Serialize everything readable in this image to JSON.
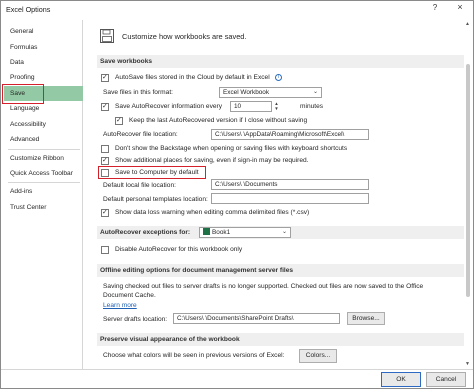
{
  "window": {
    "title": "Excel Options",
    "help_icon": "?",
    "close_icon": "×"
  },
  "sidebar": {
    "items": [
      {
        "label": "General"
      },
      {
        "label": "Formulas"
      },
      {
        "label": "Data"
      },
      {
        "label": "Proofing"
      },
      {
        "label": "Save",
        "selected": true
      },
      {
        "label": "Language"
      },
      {
        "label": "Accessibility"
      },
      {
        "label": "Advanced"
      },
      {
        "label": "Customize Ribbon"
      },
      {
        "label": "Quick Access Toolbar"
      },
      {
        "label": "Add-ins"
      },
      {
        "label": "Trust Center"
      }
    ]
  },
  "header": {
    "icon": "floppy-disk-icon",
    "text": "Customize how workbooks are saved."
  },
  "save_workbooks": {
    "title": "Save workbooks",
    "autosave_label": "AutoSave files stored in the Cloud by default in Excel",
    "save_format_label": "Save files in this format:",
    "save_format_value": "Excel Workbook",
    "autorecover_label": "Save AutoRecover information every",
    "autorecover_minutes": "10",
    "minutes_label": "minutes",
    "keep_last_label": "Keep the last AutoRecovered version if I close without saving",
    "autorecover_location_label": "AutoRecover file location:",
    "autorecover_location_value": "C:\\Users\\          \\AppData\\Roaming\\Microsoft\\Excel\\",
    "backstage_label": "Don't show the Backstage when opening or saving files with keyboard shortcuts",
    "additional_places_label": "Show additional places for saving, even if sign-in may be required.",
    "save_to_computer_label": "Save to Computer by default",
    "default_local_label": "Default local file location:",
    "default_local_value": "C:\\Users\\          \\Documents",
    "personal_templates_label": "Default personal templates location:",
    "personal_templates_value": "",
    "data_loss_label": "Show data loss warning when editing comma delimited files (*.csv)"
  },
  "autorecover_exceptions": {
    "title": "AutoRecover exceptions for:",
    "workbook_value": "Book1",
    "disable_label": "Disable AutoRecover for this workbook only"
  },
  "offline_editing": {
    "title": "Offline editing options for document management server files",
    "text_line1": "Saving checked out files to server drafts is no longer supported. Checked out files are now saved to the Office",
    "text_line2": "Document Cache.",
    "learn_more": "Learn more",
    "server_drafts_label": "Server drafts location:",
    "server_drafts_value": "C:\\Users\\          \\Documents\\SharePoint Drafts\\",
    "browse_label": "Browse..."
  },
  "preserve_visual": {
    "title": "Preserve visual appearance of the workbook",
    "colors_text": "Choose what colors will be seen in previous versions of Excel:",
    "colors_button": "Colors..."
  },
  "footer": {
    "ok_label": "OK",
    "cancel_label": "Cancel"
  },
  "colors": {
    "selected_nav": "#93c9a4",
    "highlight_red": "#d4202a",
    "section_bg": "#efefef",
    "excel_green": "#1e7145"
  }
}
